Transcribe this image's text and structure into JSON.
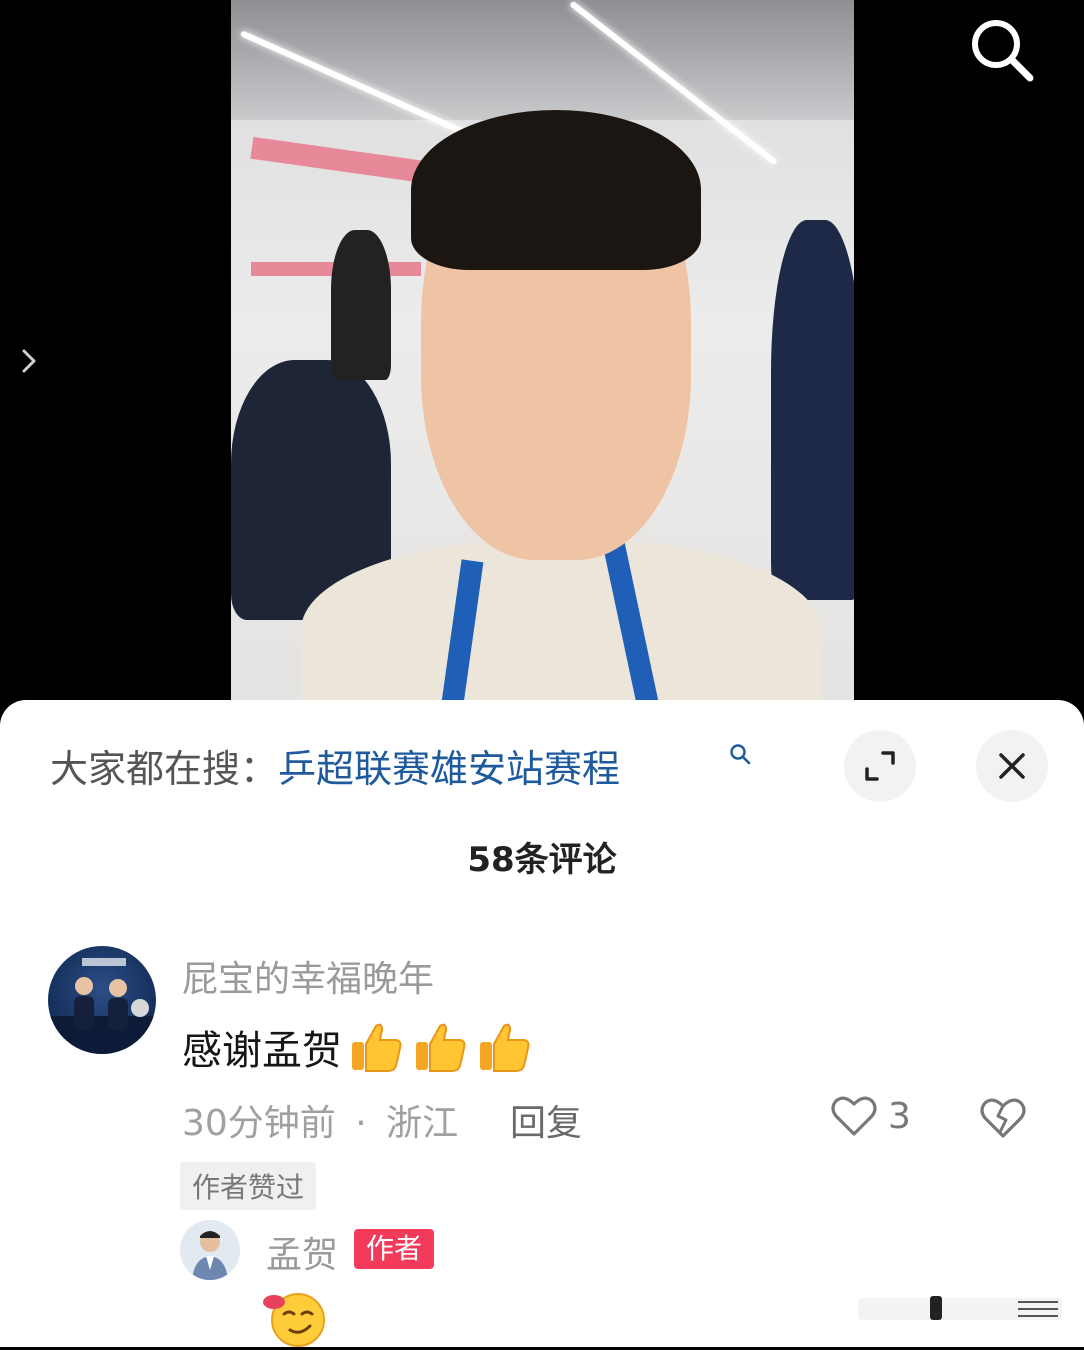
{
  "search_hint": {
    "prefix": "大家都在搜：",
    "query": "乒超联赛雄安站赛程"
  },
  "comments_header": {
    "count_label": "58条评论"
  },
  "comment": {
    "username": "屁宝的幸福晚年",
    "text": "感谢孟贺",
    "emoji": [
      "thumbs-up",
      "thumbs-up",
      "thumbs-up"
    ],
    "time": "30分钟前",
    "separator": "·",
    "location": "浙江",
    "reply_label": "回复",
    "like_count": "3",
    "liked_by_author_badge": "作者赞过"
  },
  "reply": {
    "username": "孟贺",
    "author_badge": "作者",
    "emoji": "smirk-face"
  },
  "icons": {
    "search": "search-icon",
    "side_arrow": "chevron-right-icon",
    "expand": "expand-icon",
    "close": "close-icon",
    "like": "heart-icon",
    "dislike": "broken-heart-icon"
  },
  "colors": {
    "link": "#1e5a9c",
    "author_badge": "#f23a5a",
    "sheet_bg": "#ffffff"
  }
}
